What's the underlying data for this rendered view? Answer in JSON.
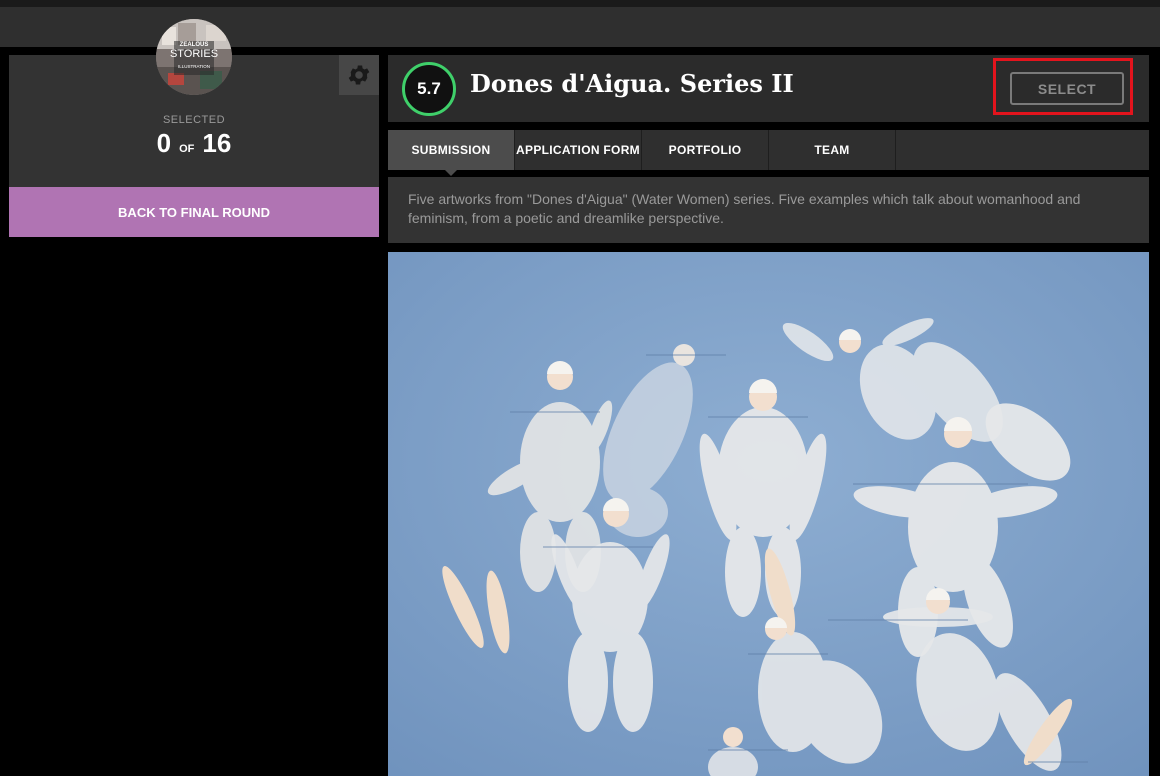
{
  "sidebar": {
    "avatar_text_1": "ZEALOUS",
    "avatar_text_2": "STORIES",
    "avatar_text_3": "ILLUSTRATION",
    "selected_label": "SELECTED",
    "selected_count": "0",
    "of_label": "OF",
    "total_count": "16",
    "back_button": "BACK TO FINAL ROUND",
    "back_color": "#b074b3"
  },
  "submission": {
    "score": "5.7",
    "score_color": "#3fd06a",
    "title": "Dones d'Aigua. Series II",
    "select_button": "SELECT",
    "description": "Five artworks from \"Dones d'Aigua\" (Water Women) series. Five examples which talk about womanhood and feminism, from a poetic and dreamlike perspective."
  },
  "tabs": [
    {
      "label": "SUBMISSION",
      "active": true
    },
    {
      "label": "APPLICATION FORM",
      "active": false
    },
    {
      "label": "PORTFOLIO",
      "active": false
    },
    {
      "label": "TEAM",
      "active": false
    }
  ],
  "icons": {
    "settings": "gear-icon"
  },
  "artwork_image": "painting of women in white swimsuits and swim caps floating in blue water"
}
